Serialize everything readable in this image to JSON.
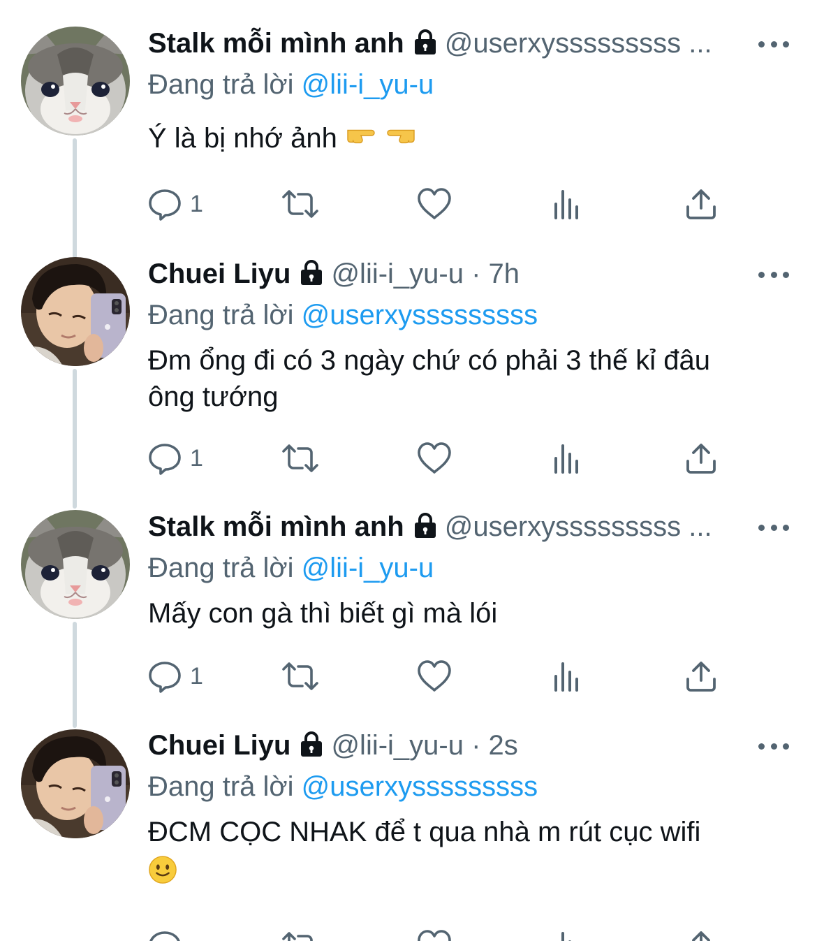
{
  "tweets": [
    {
      "display_name": "Stalk mỗi mình anh",
      "handle_meta": "@userxysssssssss ...",
      "reply_label": "Đang trả lời",
      "reply_to": "@lii-i_yu-u",
      "text": "Ý là bị nhớ ảnh",
      "text_emojis": [
        "backhand-index-pointing-right",
        "backhand-index-pointing-left"
      ],
      "reply_count": "1",
      "avatar": "cat-avatar"
    },
    {
      "display_name": "Chuei Liyu",
      "handle_meta": "@lii-i_yu-u · 7h",
      "reply_label": "Đang trả lời",
      "reply_to": "@userxysssssssss",
      "text_line1": "Đm ổng đi có 3 ngày chứ có phải 3 thế kỉ đâu",
      "text_line2": "ông tướng",
      "reply_count": "1",
      "avatar": "person-selfie-avatar"
    },
    {
      "display_name": "Stalk mỗi mình anh",
      "handle_meta": "@userxysssssssss ...",
      "reply_label": "Đang trả lời",
      "reply_to": "@lii-i_yu-u",
      "text": "Mấy con gà thì biết gì mà lói",
      "reply_count": "1",
      "avatar": "cat-avatar"
    },
    {
      "display_name": "Chuei Liyu",
      "handle_meta": "@lii-i_yu-u · 2s",
      "reply_label": "Đang trả lời",
      "reply_to": "@userxysssssssss",
      "text": "ĐCM CỌC NHAK để t qua nhà m rút cục wifi",
      "text_emojis": [
        "slightly-smiling-face"
      ],
      "avatar": "person-selfie-avatar"
    }
  ],
  "icons": {
    "reply": "comment-icon",
    "retweet": "retweet-icon",
    "like": "heart-icon",
    "stats": "stats-icon",
    "share": "share-icon",
    "more": "more-dots-icon",
    "protected": "lock-icon"
  },
  "colors": {
    "text": "#0f1419",
    "secondary": "#536471",
    "accent": "#1d9bf0",
    "thread_line": "#cfd9de"
  }
}
